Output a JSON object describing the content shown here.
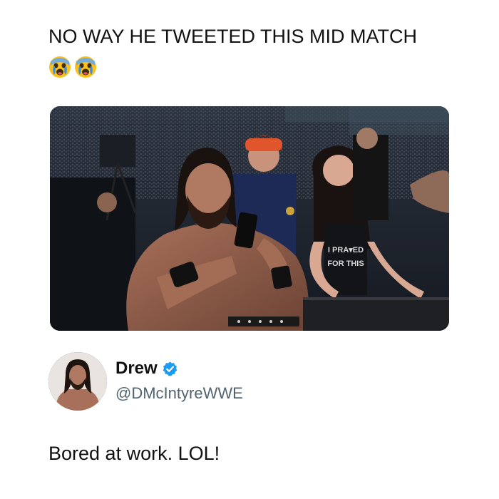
{
  "headline": {
    "text": "NO WAY HE TWEETED THIS MID MATCH",
    "emojis": [
      "crying-face-emoji",
      "crying-face-emoji"
    ]
  },
  "photo": {
    "shirt_text_line1": "I PRA",
    "shirt_text_line1_b": "ED",
    "shirt_text_line2": "FOR THIS"
  },
  "tweet": {
    "display_name": "Drew",
    "handle": "@DMcIntyreWWE",
    "verified": true,
    "verified_color": "#1d9bf0",
    "text": "Bored at work. LOL!"
  },
  "colors": {
    "handle_gray": "#536471",
    "text": "#111111",
    "background": "#ffffff"
  }
}
